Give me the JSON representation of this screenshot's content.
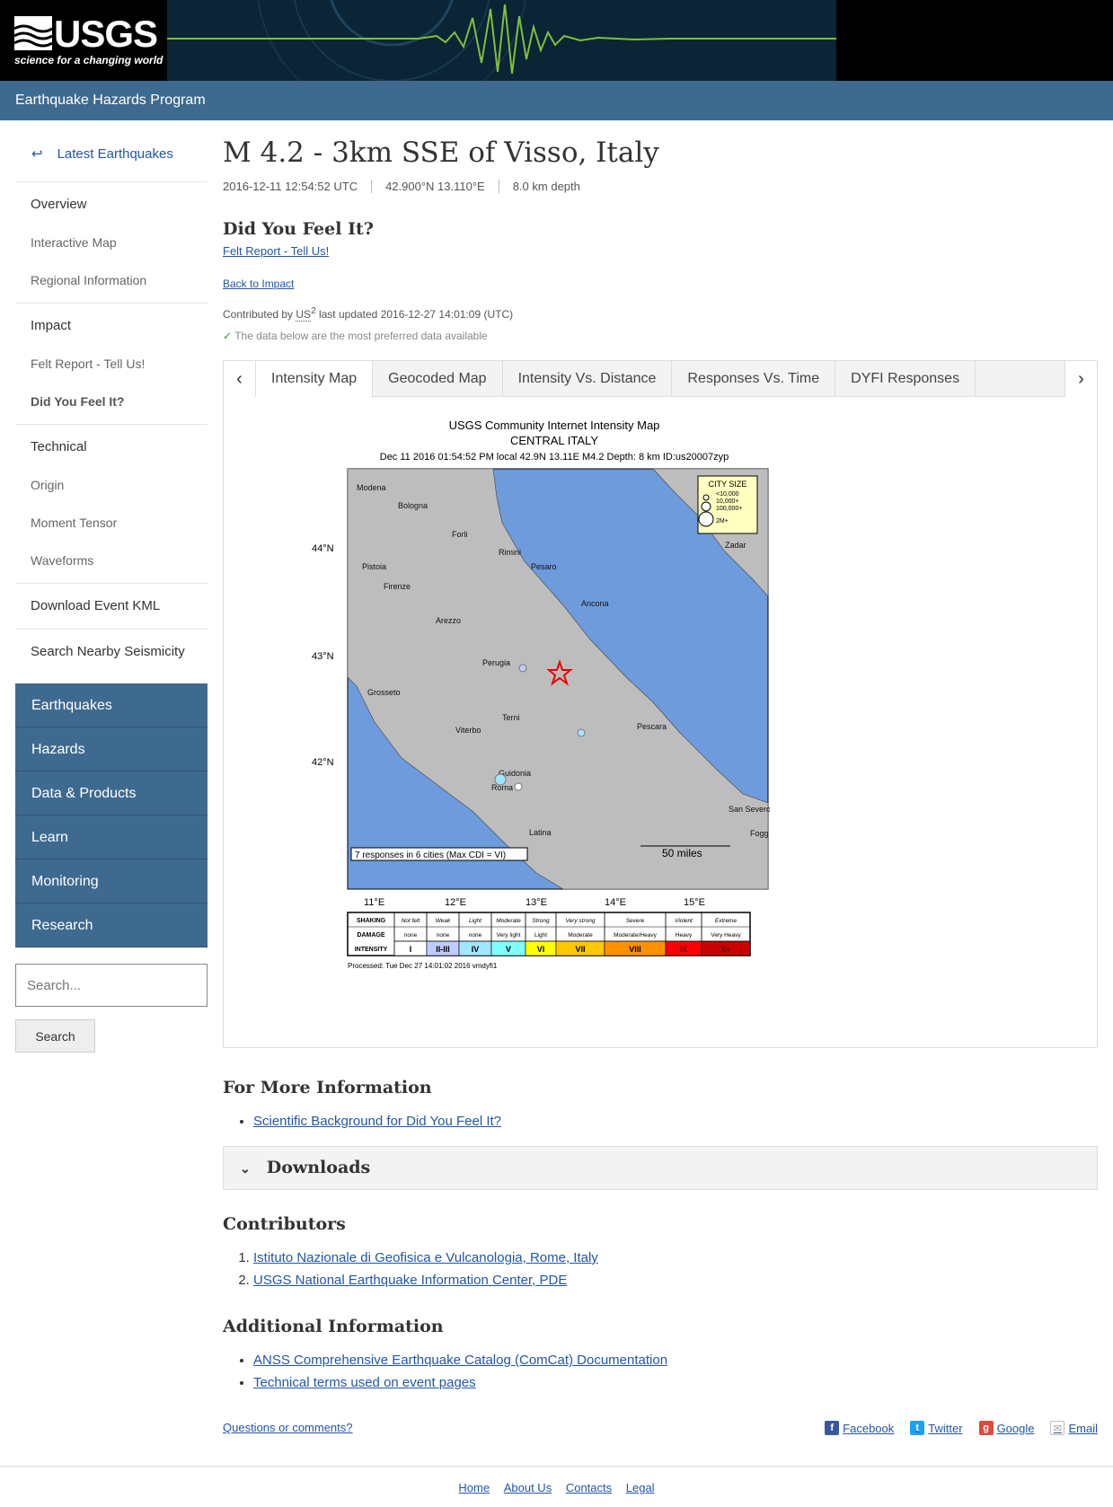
{
  "header": {
    "logo_word": "USGS",
    "logo_tagline": "science for a changing world",
    "program": "Earthquake Hazards Program"
  },
  "sidebar": {
    "back": "Latest Earthquakes",
    "group1": [
      "Overview",
      "Interactive Map",
      "Regional Information"
    ],
    "group2": [
      "Impact",
      "Felt Report - Tell Us!",
      "Did You Feel It?"
    ],
    "group3": [
      "Technical",
      "Origin",
      "Moment Tensor",
      "Waveforms"
    ],
    "download_kml": "Download Event KML",
    "search_nearby": "Search Nearby Seismicity",
    "blue_nav": [
      "Earthquakes",
      "Hazards",
      "Data & Products",
      "Learn",
      "Monitoring",
      "Research"
    ],
    "search_placeholder": "Search...",
    "search_button": "Search"
  },
  "event": {
    "title": "M 4.2 - 3km SSE of Visso, Italy",
    "time": "2016-12-11 12:54:52 UTC",
    "location": "42.900°N  13.110°E",
    "depth": "8.0 km depth"
  },
  "dyfi": {
    "heading": "Did You Feel It?",
    "felt_link": "Felt Report - Tell Us!",
    "back_link": "Back to Impact",
    "contributed_prefix": "Contributed by",
    "contributor": "US",
    "contributor_sup": "2",
    "updated": "last updated 2016-12-27 14:01:09 (UTC)",
    "preferred": "The data below are the most preferred data available"
  },
  "tabs": [
    "Intensity Map",
    "Geocoded Map",
    "Intensity Vs. Distance",
    "Responses Vs. Time",
    "DYFI Responses"
  ],
  "map": {
    "title1": "USGS Community Internet Intensity Map",
    "title2": "CENTRAL ITALY",
    "subtitle": "Dec 11 2016 01:54:52 PM local 42.9N 13.11E M4.2 Depth: 8 km ID:us20007zyp",
    "lat_labels": [
      "44°N",
      "43°N",
      "42°N"
    ],
    "lon_labels": [
      "11°E",
      "12°E",
      "13°E",
      "14°E",
      "15°E"
    ],
    "cities": [
      "Modena",
      "Bologna",
      "Forli",
      "Rimini",
      "Pesaro",
      "Pistoia",
      "Firenze",
      "Ancona",
      "Arezzo",
      "Perugia",
      "Grosseto",
      "Terni",
      "Viterbo",
      "Pescara",
      "Guidonia",
      "Roma",
      "Latina",
      "Zadar",
      "San Severo",
      "Fogg"
    ],
    "city_size_title": "CITY SIZE",
    "city_sizes": [
      "<10,000",
      "10,000+",
      "100,000+",
      "2M+"
    ],
    "responses": "7 responses in 6 cities (Max CDI = VI)",
    "scale": "50 miles",
    "legend_rows": [
      "SHAKING",
      "DAMAGE",
      "INTENSITY"
    ],
    "shaking": [
      "Not felt",
      "Weak",
      "Light",
      "Moderate",
      "Strong",
      "Very strong",
      "Severe",
      "Violent",
      "Extreme"
    ],
    "damage": [
      "none",
      "none",
      "none",
      "Very light",
      "Light",
      "Moderate",
      "Moderate/Heavy",
      "Heavy",
      "Very Heavy"
    ],
    "intensity": [
      "I",
      "II-III",
      "IV",
      "V",
      "VI",
      "VII",
      "VIII",
      "IX",
      "X+"
    ],
    "intensity_colors": [
      "#ffffff",
      "#bfccff",
      "#a0e6ff",
      "#80ffff",
      "#ffff00",
      "#ffc800",
      "#ff9100",
      "#ff0000",
      "#c80000"
    ],
    "processed": "Processed: Tue Dec 27 14:01:02 2016 vmdyfi1"
  },
  "more_info": {
    "heading": "For More Information",
    "links": [
      "Scientific Background for Did You Feel It?"
    ]
  },
  "downloads": "Downloads",
  "contributors": {
    "heading": "Contributors",
    "items": [
      "Istituto Nazionale di Geofisica e Vulcanologia, Rome, Italy",
      "USGS National Earthquake Information Center, PDE"
    ]
  },
  "additional": {
    "heading": "Additional Information",
    "links": [
      "ANSS Comprehensive Earthquake Catalog (ComCat) Documentation",
      "Technical terms used on event pages"
    ]
  },
  "footer": {
    "questions": "Questions or comments?",
    "share": [
      "Facebook",
      "Twitter",
      "Google",
      "Email"
    ],
    "bottom": [
      "Home",
      "About Us",
      "Contacts",
      "Legal"
    ]
  }
}
